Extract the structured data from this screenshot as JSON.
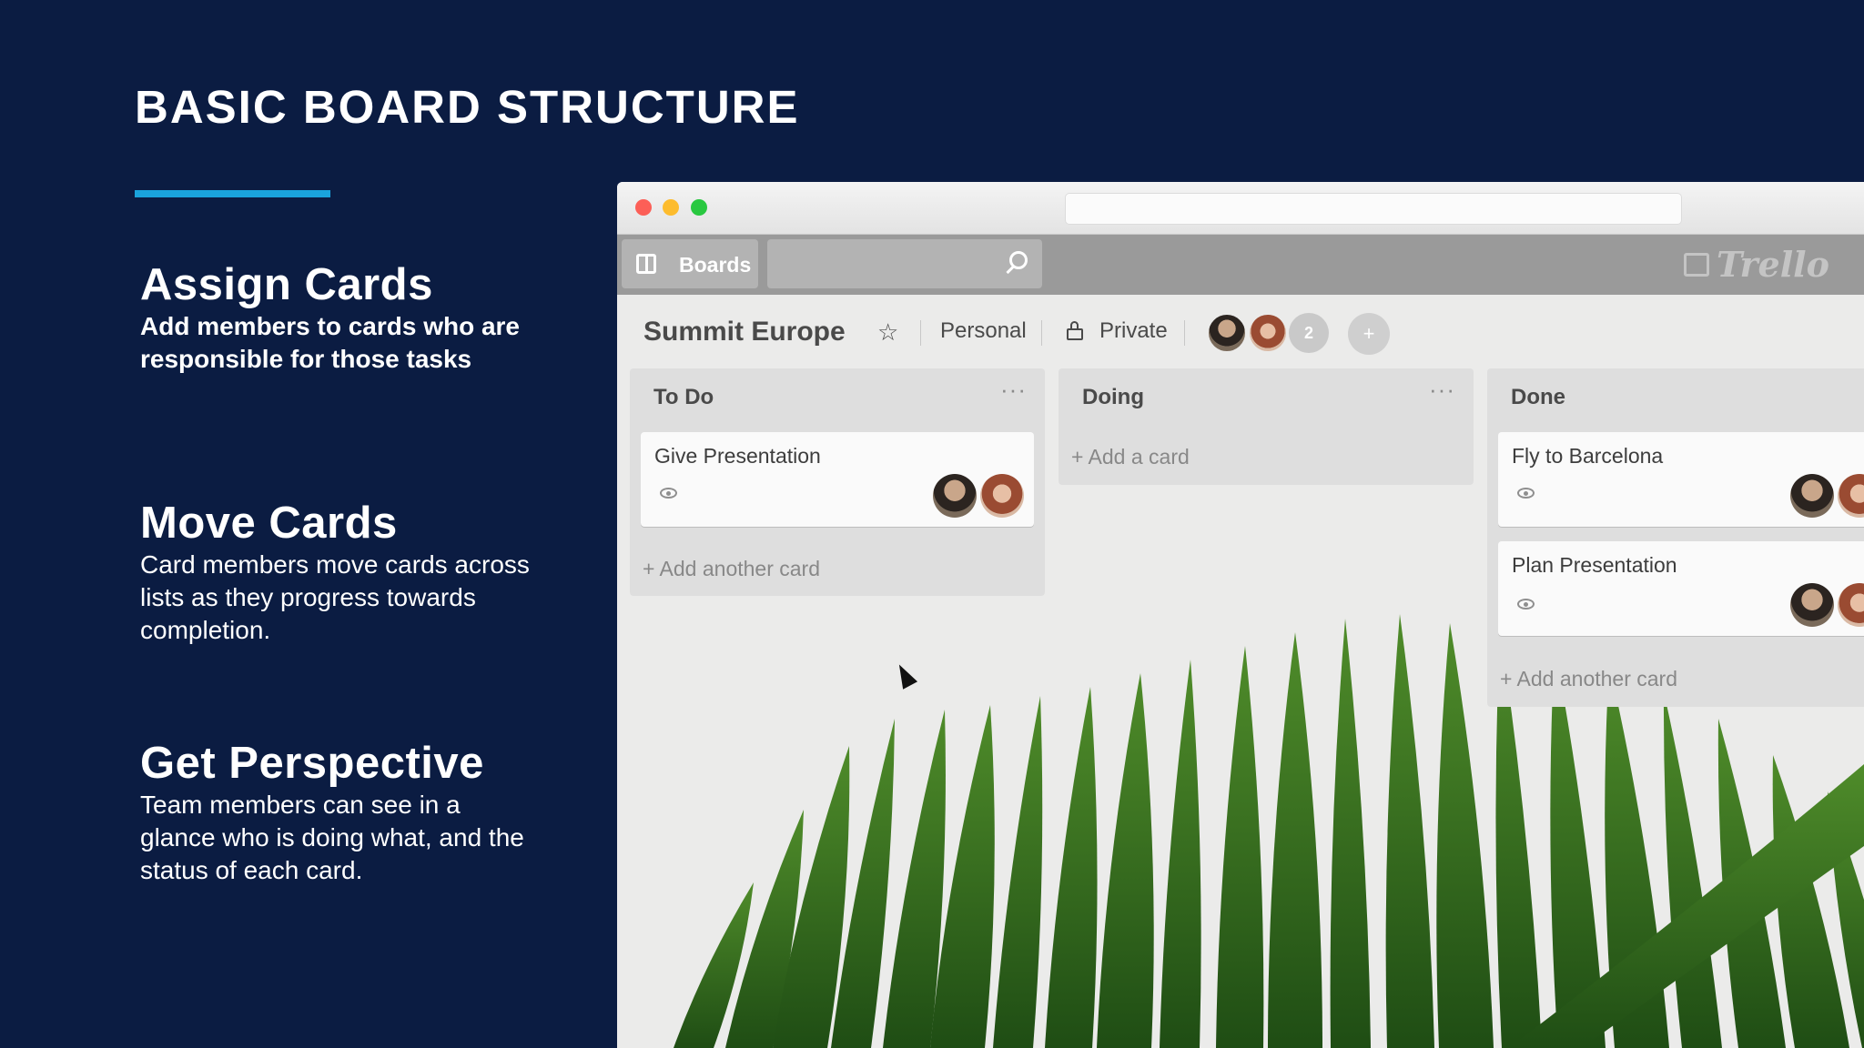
{
  "slide": {
    "title": "BASIC BOARD STRUCTURE",
    "accent_color": "#1aa3dc",
    "points": [
      {
        "heading": "Assign Cards",
        "description": "Add members to cards who are responsible for those tasks"
      },
      {
        "heading": "Move Cards",
        "description": "Card members move cards across lists as they progress towards completion."
      },
      {
        "heading": "Get Perspective",
        "description": "Team members can see in a glance who is doing what, and the status of each card."
      }
    ]
  },
  "trello": {
    "header": {
      "boards_label": "Boards",
      "boards_icon": "board-icon",
      "search_icon": "search-icon",
      "logo_text": "Trello"
    },
    "board": {
      "name": "Summit Europe",
      "visibility_team": "Personal",
      "visibility_privacy": "Private",
      "extra_members_count": "2",
      "icons": [
        "star-icon",
        "lock-icon",
        "add-member-icon"
      ]
    },
    "lists": [
      {
        "title": "To Do",
        "menu": "···",
        "cards": [
          {
            "title": "Give Presentation"
          }
        ],
        "add_label": "+ Add another card"
      },
      {
        "title": "Doing",
        "menu": "···",
        "cards": [],
        "add_label": "+ Add a card"
      },
      {
        "title": "Done",
        "menu": "",
        "cards": [
          {
            "title": "Fly to Barcelona"
          },
          {
            "title": "Plan Presentation"
          }
        ],
        "add_label": "+ Add another card"
      }
    ]
  }
}
